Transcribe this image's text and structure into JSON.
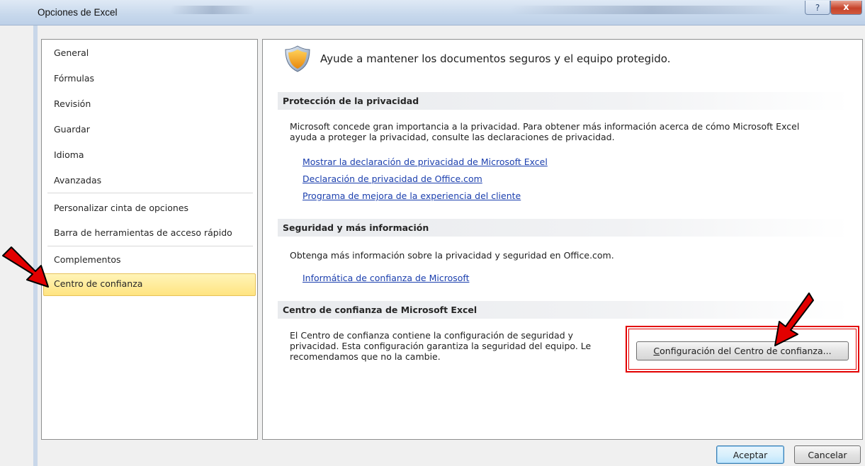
{
  "window": {
    "title": "Opciones de Excel",
    "help_glyph": "?",
    "close_glyph": "x"
  },
  "nav": {
    "items": [
      {
        "label": "General"
      },
      {
        "label": "Fórmulas"
      },
      {
        "label": "Revisión"
      },
      {
        "label": "Guardar"
      },
      {
        "label": "Idioma"
      },
      {
        "label": "Avanzadas"
      },
      {
        "label": "Personalizar cinta de opciones"
      },
      {
        "label": "Barra de herramientas de acceso rápido"
      },
      {
        "label": "Complementos"
      },
      {
        "label": "Centro de confianza",
        "selected": true
      }
    ]
  },
  "content": {
    "headline": "Ayude a mantener los documentos seguros y el equipo protegido.",
    "privacy": {
      "header": "Protección de la privacidad",
      "text_line1": "Microsoft concede gran importancia a la privacidad. Para obtener más información acerca de cómo Microsoft Excel",
      "text_line2": "ayuda a proteger la privacidad, consulte las declaraciones de privacidad.",
      "links": [
        "Mostrar la declaración de privacidad de Microsoft Excel",
        "Declaración de privacidad de Office.com",
        "Programa de mejora de la experiencia del cliente"
      ]
    },
    "security": {
      "header": "Seguridad y más información",
      "text": "Obtenga más información sobre la privacidad y seguridad en Office.com.",
      "link": "Informática de confianza de Microsoft"
    },
    "trust_center": {
      "header": "Centro de confianza de Microsoft Excel",
      "text_line1": "El Centro de confianza contiene la configuración de seguridad y",
      "text_line2": "privacidad. Esta configuración garantiza la seguridad del equipo. Le",
      "text_line3": "recomendamos que no la cambie.",
      "button_mnemonic": "C",
      "button_rest": "onfiguración del Centro de confianza..."
    }
  },
  "footer": {
    "ok_label": "Aceptar",
    "cancel_label": "Cancelar"
  },
  "colors": {
    "link": "#1b3fae",
    "annotation_red": "#e20000",
    "selected_item": "#ffe481"
  }
}
